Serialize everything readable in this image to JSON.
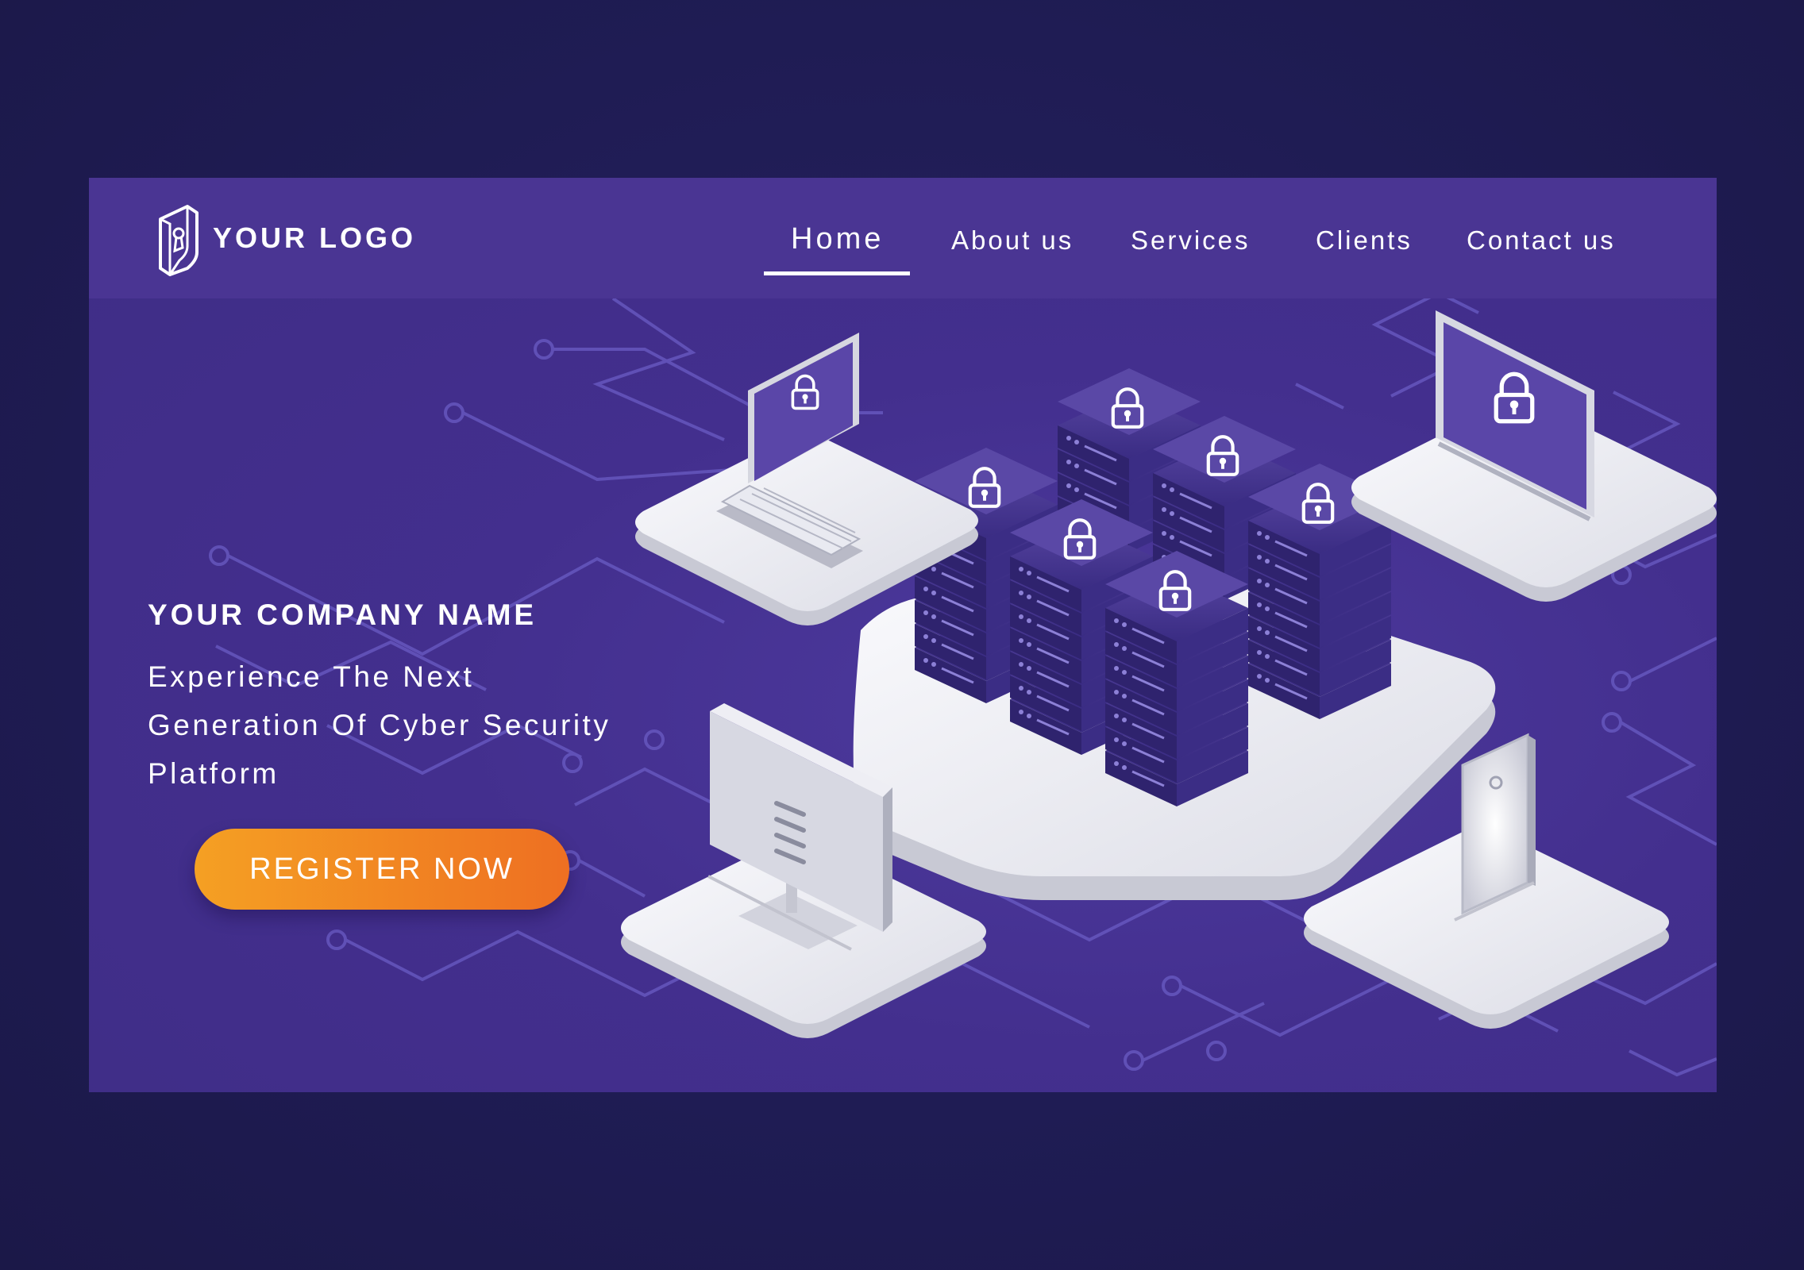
{
  "logo": {
    "text": "YOUR LOGO",
    "icon": "shield-keyhole-icon"
  },
  "nav": {
    "items": [
      {
        "label": "Home",
        "active": true
      },
      {
        "label": "About us",
        "active": false
      },
      {
        "label": "Services",
        "active": false
      },
      {
        "label": "Clients",
        "active": false
      },
      {
        "label": "Contact us",
        "active": false
      }
    ]
  },
  "hero": {
    "company": "YOUR COMPANY NAME",
    "tagline_lines": [
      "Experience The Next",
      "Generation Of Cyber Security",
      "Platform"
    ],
    "cta_label": "REGISTER NOW"
  },
  "illustration": {
    "elements": [
      "laptop-lock",
      "monitor-lock",
      "server-stacks-lock",
      "desktop-computer",
      "smartphone",
      "circuit-lines"
    ],
    "icon": "padlock-icon"
  },
  "colors": {
    "page_bg": "#1f1c54",
    "card_bg": "#432f8e",
    "nav_bg": "#4a3593",
    "server": "#3c2d86",
    "platform": "#e6e7ee",
    "cta_start": "#f5a023",
    "cta_end": "#ee6f22",
    "circuit": "#6a5cc4"
  }
}
